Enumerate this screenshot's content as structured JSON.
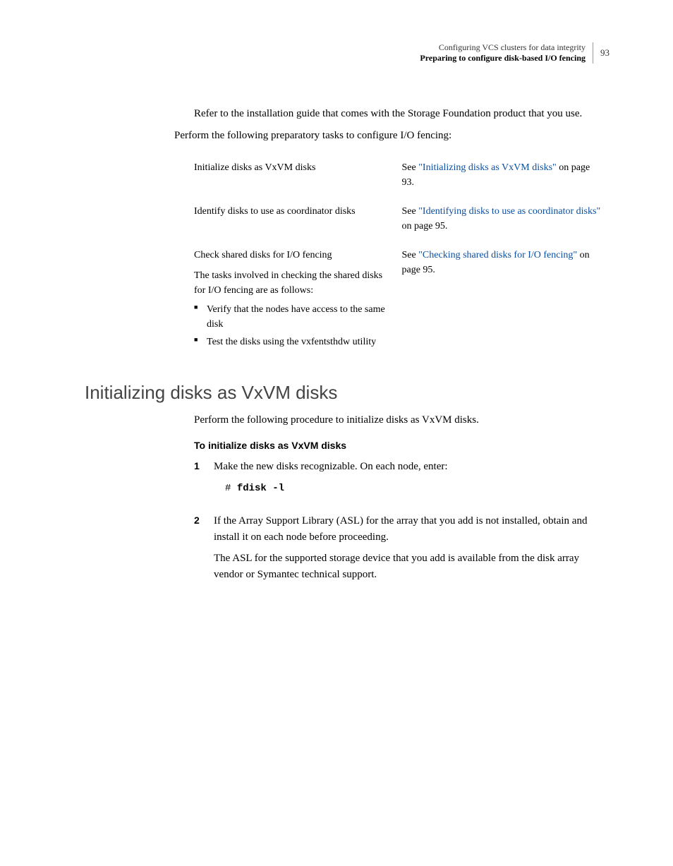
{
  "header": {
    "chapter": "Configuring VCS clusters for data integrity",
    "section": "Preparing to configure disk-based I/O fencing",
    "page_number": "93"
  },
  "intro": {
    "para1": "Refer to the installation guide that comes with the Storage Foundation product that you use.",
    "para2": "Perform the following preparatory tasks to configure I/O fencing:"
  },
  "task_rows": {
    "row1_left": "Initialize disks as VxVM disks",
    "row1_right_prefix": "See ",
    "row1_right_link": "\"Initializing disks as VxVM disks\"",
    "row1_right_suffix": " on page 93.",
    "row2_left": "Identify disks to use as coordinator disks",
    "row2_right_prefix": "See ",
    "row2_right_link": "\"Identifying disks to use as coordinator disks\"",
    "row2_right_suffix": " on page 95.",
    "row3_left_line1": "Check shared disks for I/O fencing",
    "row3_left_line2": "The tasks involved in checking the shared disks for I/O fencing are as follows:",
    "row3_bullet1": "Verify that the nodes have access to the same disk",
    "row3_bullet2": "Test the disks using the vxfentsthdw utility",
    "row3_right_prefix": "See ",
    "row3_right_link": "\"Checking shared disks for I/O fencing\"",
    "row3_right_suffix": " on page 95."
  },
  "section_heading": "Initializing disks as VxVM disks",
  "section_intro": "Perform the following procedure to initialize disks as VxVM disks.",
  "procedure_title": "To initialize disks as VxVM disks",
  "steps": {
    "s1_num": "1",
    "s1_text": "Make the new disks recognizable. On each node, enter:",
    "s1_prompt": "# ",
    "s1_cmd": "fdisk -l",
    "s2_num": "2",
    "s2_text": "If the Array Support Library (ASL) for the array that you add is not installed, obtain and install it on each node before proceeding.",
    "s2_text2": "The ASL for the supported storage device that you add is available from the disk array vendor or Symantec technical support."
  }
}
